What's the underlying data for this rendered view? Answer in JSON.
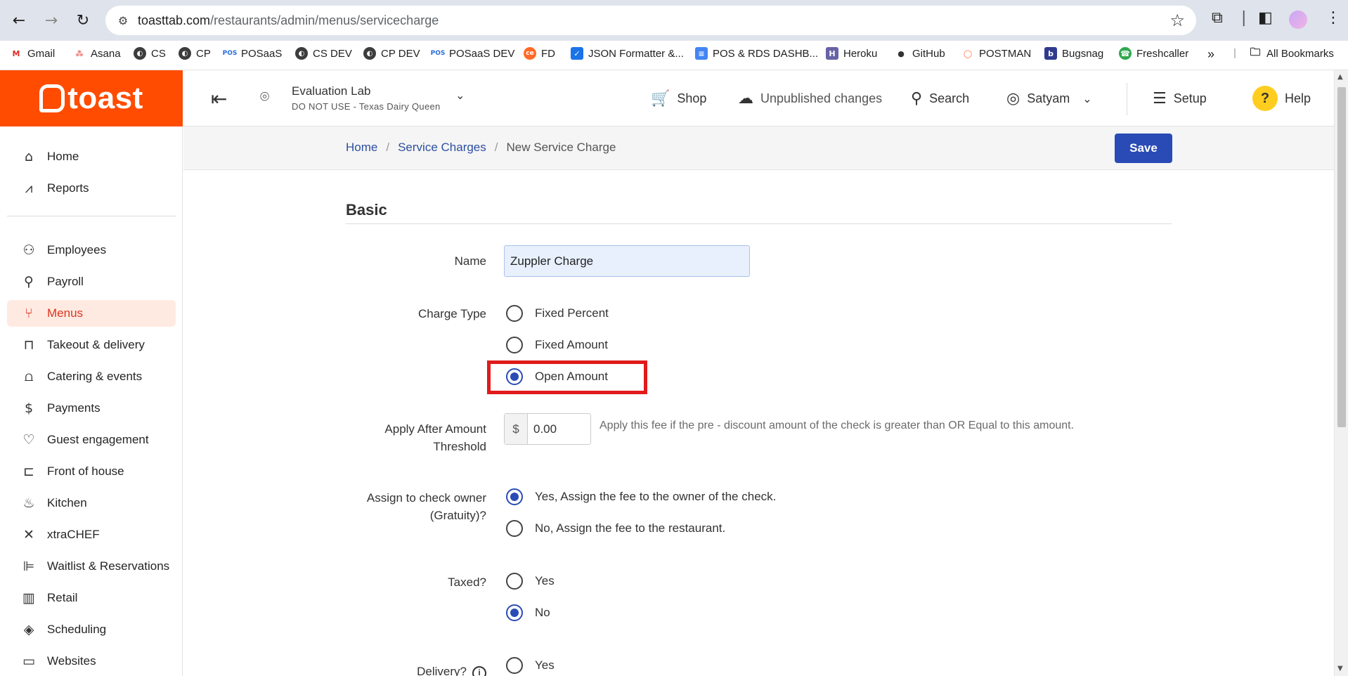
{
  "browser": {
    "url_host": "toasttab.com",
    "url_path": "/restaurants/admin/menus/servicecharge",
    "bookmarks": [
      {
        "label": "Gmail",
        "icon": "gmail-icon"
      },
      {
        "label": "Asana",
        "icon": "asana-icon"
      },
      {
        "label": "CS",
        "icon": "globe-icon"
      },
      {
        "label": "CP",
        "icon": "globe-icon"
      },
      {
        "label": "POSaaS",
        "icon": "pos-icon"
      },
      {
        "label": "CS DEV",
        "icon": "globe-icon"
      },
      {
        "label": "CP DEV",
        "icon": "globe-icon"
      },
      {
        "label": "POSaaS DEV",
        "icon": "pos-icon"
      },
      {
        "label": "FD",
        "icon": "freshdesk-icon"
      },
      {
        "label": "JSON Formatter &...",
        "icon": "check-icon"
      },
      {
        "label": "POS & RDS DASHB...",
        "icon": "doc-icon"
      },
      {
        "label": "Heroku",
        "icon": "heroku-icon"
      },
      {
        "label": "GitHub",
        "icon": "github-icon"
      },
      {
        "label": "POSTMAN",
        "icon": "postman-icon"
      },
      {
        "label": "Bugsnag",
        "icon": "bugsnag-icon"
      },
      {
        "label": "Freshcaller",
        "icon": "freshcaller-icon"
      }
    ],
    "all_bookmarks": "All Bookmarks"
  },
  "header": {
    "logo": "toast",
    "location_name": "Evaluation Lab",
    "location_sub": "DO NOT USE - Texas Dairy Queen",
    "shop": "Shop",
    "unpublished": "Unpublished changes",
    "search": "Search",
    "user": "Satyam",
    "setup": "Setup",
    "help": "Help"
  },
  "sidebar": {
    "items": [
      {
        "label": "Home",
        "icon": "home-icon"
      },
      {
        "label": "Reports",
        "icon": "reports-icon"
      },
      {
        "label": "Employees",
        "icon": "employees-icon"
      },
      {
        "label": "Payroll",
        "icon": "payroll-icon"
      },
      {
        "label": "Menus",
        "icon": "menus-icon",
        "active": true
      },
      {
        "label": "Takeout & delivery",
        "icon": "takeout-icon"
      },
      {
        "label": "Catering & events",
        "icon": "catering-icon"
      },
      {
        "label": "Payments",
        "icon": "payments-icon"
      },
      {
        "label": "Guest engagement",
        "icon": "guest-icon"
      },
      {
        "label": "Front of house",
        "icon": "front-of-house-icon"
      },
      {
        "label": "Kitchen",
        "icon": "kitchen-icon"
      },
      {
        "label": "xtraCHEF",
        "icon": "xtrachef-icon"
      },
      {
        "label": "Waitlist & Reservations",
        "icon": "waitlist-icon"
      },
      {
        "label": "Retail",
        "icon": "retail-icon"
      },
      {
        "label": "Scheduling",
        "icon": "scheduling-icon"
      },
      {
        "label": "Websites",
        "icon": "websites-icon"
      }
    ]
  },
  "breadcrumb": {
    "home": "Home",
    "service_charges": "Service Charges",
    "current": "New Service Charge",
    "save": "Save"
  },
  "form": {
    "section": "Basic",
    "name_label": "Name",
    "name_value": "Zuppler Charge",
    "charge_type_label": "Charge Type",
    "charge_types": [
      "Fixed Percent",
      "Fixed Amount",
      "Open Amount"
    ],
    "charge_type_selected": "Open Amount",
    "threshold_label_1": "Apply After Amount",
    "threshold_label_2": "Threshold",
    "currency": "$",
    "threshold_value": "0.00",
    "threshold_help": "Apply this fee if the pre - discount amount of the check is greater than OR Equal to this amount.",
    "assign_label_1": "Assign to check owner",
    "assign_label_2": "(Gratuity)?",
    "assign_yes": "Yes, Assign the fee to the owner of the check.",
    "assign_no": "No, Assign the fee to the restaurant.",
    "taxed_label": "Taxed?",
    "taxed_yes": "Yes",
    "taxed_no": "No",
    "delivery_label": "Delivery?",
    "delivery_yes": "Yes"
  },
  "colors": {
    "brand": "#ff4c00",
    "primary": "#2a4bb6",
    "highlight": "#e01b1b"
  }
}
